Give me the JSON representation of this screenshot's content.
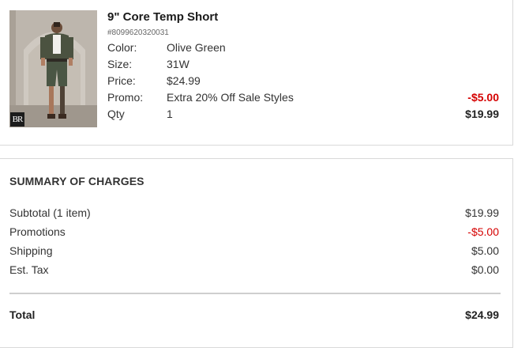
{
  "item": {
    "title": "9\" Core Temp Short",
    "sku": "#8099620320031",
    "attributes": [
      {
        "label": "Color:",
        "value": "Olive Green"
      },
      {
        "label": "Size:",
        "value": "31W"
      },
      {
        "label": "Price:",
        "value": "$24.99"
      },
      {
        "label": "Promo:",
        "value": "Extra 20% Off Sale Styles"
      },
      {
        "label": "Qty",
        "value": "1"
      }
    ],
    "promo_amount": "-$5.00",
    "line_price": "$19.99",
    "image_badge": "BR"
  },
  "summary": {
    "title": "SUMMARY OF CHARGES",
    "rows": [
      {
        "label": "Subtotal (1 item)",
        "value": "$19.99"
      },
      {
        "label": "Promotions",
        "value": "-$5.00"
      },
      {
        "label": "Shipping",
        "value": "$5.00"
      },
      {
        "label": "Est. Tax",
        "value": "$0.00"
      }
    ],
    "total_label": "Total",
    "total_value": "$24.99"
  },
  "colors": {
    "promo_red": "#d50000",
    "text": "#333333",
    "border": "#d9d9d9"
  }
}
